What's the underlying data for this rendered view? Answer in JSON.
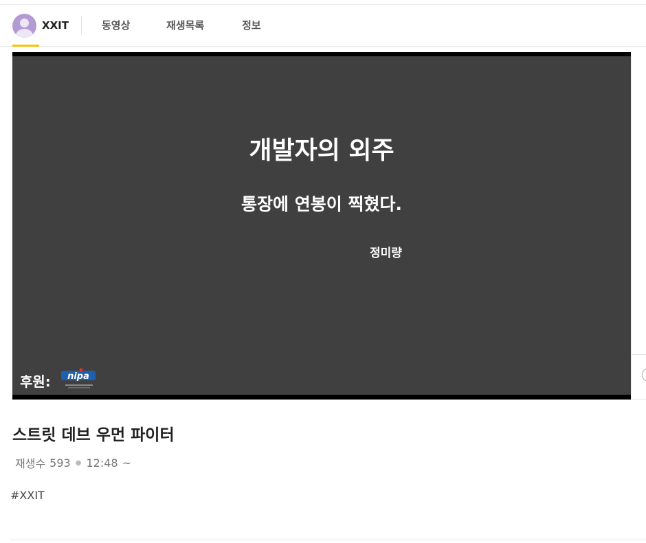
{
  "header": {
    "channel_name": "XXIT",
    "tabs": [
      {
        "label": "동영상"
      },
      {
        "label": "재생목록"
      },
      {
        "label": "정보"
      }
    ]
  },
  "video_slide": {
    "title": "개발자의 외주",
    "subtitle": "통장에 연봉이 찍혔다.",
    "author": "정미량",
    "sponsor_label": "후원:",
    "sponsor_logo_text": "nipa",
    "background_color": "#404040"
  },
  "video": {
    "title": "스트릿 데브 우먼 파이터",
    "views_label": "재생수",
    "views": "593",
    "duration": "12:48",
    "tilde": "~",
    "hashtag": "#XXIT"
  },
  "colors": {
    "accent": "#f5c400",
    "avatar": "#b39ad3"
  },
  "icons": [
    "avatar-icon",
    "sponsor-logo-icon",
    "next-arrow-icon"
  ]
}
